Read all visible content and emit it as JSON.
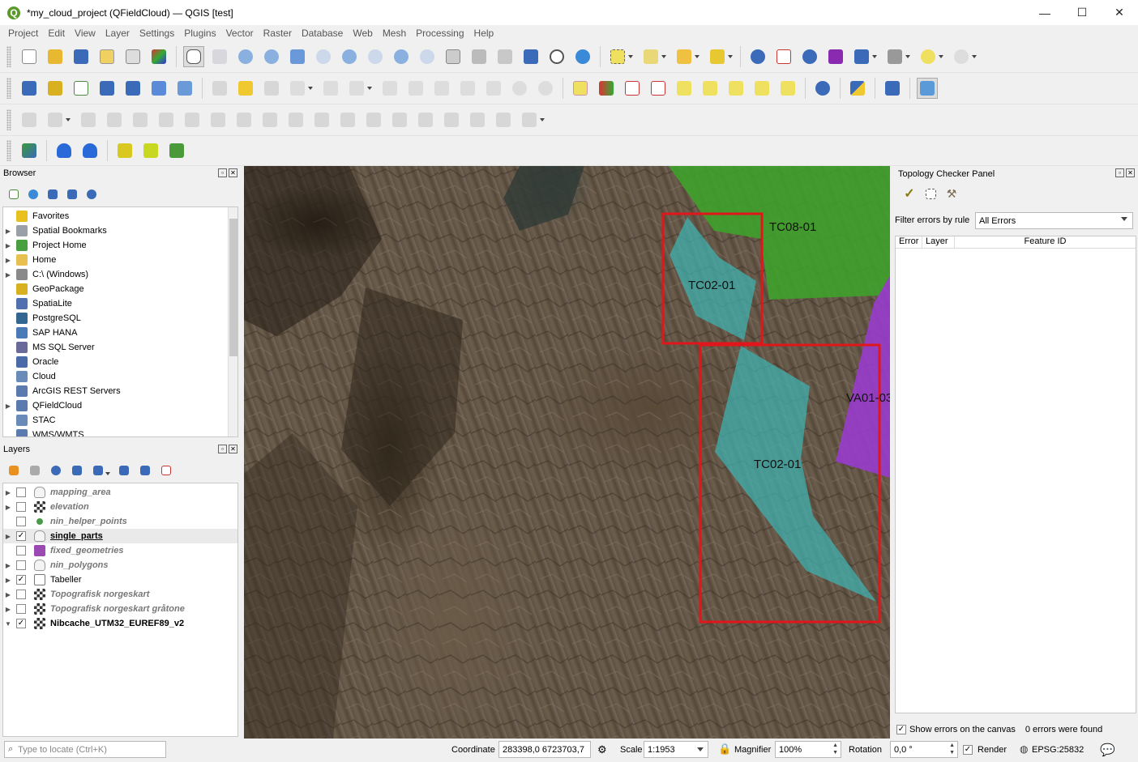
{
  "window": {
    "title": "*my_cloud_project (QFieldCloud) — QGIS [test]",
    "minimize": "—",
    "maximize": "☐",
    "close": "✕"
  },
  "menu": [
    "Project",
    "Edit",
    "View",
    "Layer",
    "Settings",
    "Plugins",
    "Vector",
    "Raster",
    "Database",
    "Web",
    "Mesh",
    "Processing",
    "Help"
  ],
  "browser": {
    "title": "Browser",
    "items": [
      {
        "label": "Favorites",
        "icon": "star-icon",
        "color": "#e8c020",
        "expand": false
      },
      {
        "label": "Spatial Bookmarks",
        "icon": "bookmark-icon",
        "color": "#9aa0a8",
        "expand": true
      },
      {
        "label": "Project Home",
        "icon": "project-home-icon",
        "color": "#4aa040",
        "expand": true
      },
      {
        "label": "Home",
        "icon": "folder-icon",
        "color": "#e8c050",
        "expand": true
      },
      {
        "label": "C:\\ (Windows)",
        "icon": "drive-icon",
        "color": "#8a8a8a",
        "expand": true
      },
      {
        "label": "GeoPackage",
        "icon": "geopackage-icon",
        "color": "#d8b020",
        "expand": false
      },
      {
        "label": "SpatiaLite",
        "icon": "spatialite-icon",
        "color": "#5070b0",
        "expand": false
      },
      {
        "label": "PostgreSQL",
        "icon": "postgresql-icon",
        "color": "#336791",
        "expand": false
      },
      {
        "label": "SAP HANA",
        "icon": "sap-hana-icon",
        "color": "#4a7ab8",
        "expand": false
      },
      {
        "label": "MS SQL Server",
        "icon": "mssql-icon",
        "color": "#6a6a9a",
        "expand": false
      },
      {
        "label": "Oracle",
        "icon": "oracle-icon",
        "color": "#4a6aa8",
        "expand": false
      },
      {
        "label": "Cloud",
        "icon": "cloud-icon",
        "color": "#6a8ab8",
        "expand": false
      },
      {
        "label": "ArcGIS REST Servers",
        "icon": "globe-icon",
        "color": "#5a7ab0",
        "expand": false
      },
      {
        "label": "QFieldCloud",
        "icon": "qfieldcloud-icon",
        "color": "#5a7ab0",
        "expand": true
      },
      {
        "label": "STAC",
        "icon": "stac-icon",
        "color": "#6a8ab8",
        "expand": false
      },
      {
        "label": "WMS/WMTS",
        "icon": "wms-icon",
        "color": "#5a7ab0",
        "expand": false
      }
    ]
  },
  "layers": {
    "title": "Layers",
    "items": [
      {
        "label": "mapping_area",
        "checked": false,
        "style": "italic",
        "icon": "polygon-layer-icon",
        "color": "#cfcfcf"
      },
      {
        "label": "elevation",
        "checked": false,
        "style": "italic",
        "icon": "raster-layer-icon",
        "color": "#333"
      },
      {
        "label": "nin_helper_points",
        "checked": false,
        "style": "italic",
        "icon": "point-layer-icon",
        "color": "#4a9a4a"
      },
      {
        "label": "single_parts",
        "checked": true,
        "style": "bold-underline",
        "icon": "polygon-layer-icon",
        "color": "#cfcfcf"
      },
      {
        "label": "fixed_geometries",
        "checked": false,
        "style": "italic",
        "icon": "polygon-fill-icon",
        "color": "#9a4ab0"
      },
      {
        "label": "nin_polygons",
        "checked": false,
        "style": "italic",
        "icon": "polygon-layer-icon",
        "color": "#cfcfcf"
      },
      {
        "label": "Tabeller",
        "checked": true,
        "style": "normal",
        "icon": "group-icon",
        "color": "#888"
      },
      {
        "label": "Topografisk norgeskart",
        "checked": false,
        "style": "italic",
        "icon": "raster-layer-icon",
        "color": "#333"
      },
      {
        "label": "Topografisk norgeskart gråtone",
        "checked": false,
        "style": "italic",
        "icon": "raster-layer-icon",
        "color": "#333"
      },
      {
        "label": "Nibcache_UTM32_EUREF89_v2",
        "checked": true,
        "style": "bold",
        "icon": "raster-layer-icon",
        "color": "#333"
      }
    ]
  },
  "map": {
    "labels": {
      "tc0801": "TC08-01",
      "tc0201a": "TC02-01",
      "tc0201b": "TC02-01",
      "va01": "VA01-03"
    },
    "colors": {
      "green": "#3ea32a",
      "cyan": "#3fb3b3",
      "purple": "#9a3bd0",
      "red": "#e0161a"
    }
  },
  "topology": {
    "title": "Topology Checker Panel",
    "filter_label": "Filter errors by rule",
    "filter_value": "All Errors",
    "columns": [
      "Error",
      "Layer",
      "Feature ID"
    ],
    "show_errors_label": "Show errors on the canvas",
    "errors_found": "0 errors were found"
  },
  "status": {
    "locate_placeholder": "Type to locate (Ctrl+K)",
    "coordinate_label": "Coordinate",
    "coordinate_value": "283398,0  6723703,7",
    "scale_label": "Scale",
    "scale_value": "1:1953",
    "magnifier_label": "Magnifier",
    "magnifier_value": "100%",
    "rotation_label": "Rotation",
    "rotation_value": "0,0 °",
    "render_label": "Render",
    "crs": "EPSG:25832"
  }
}
